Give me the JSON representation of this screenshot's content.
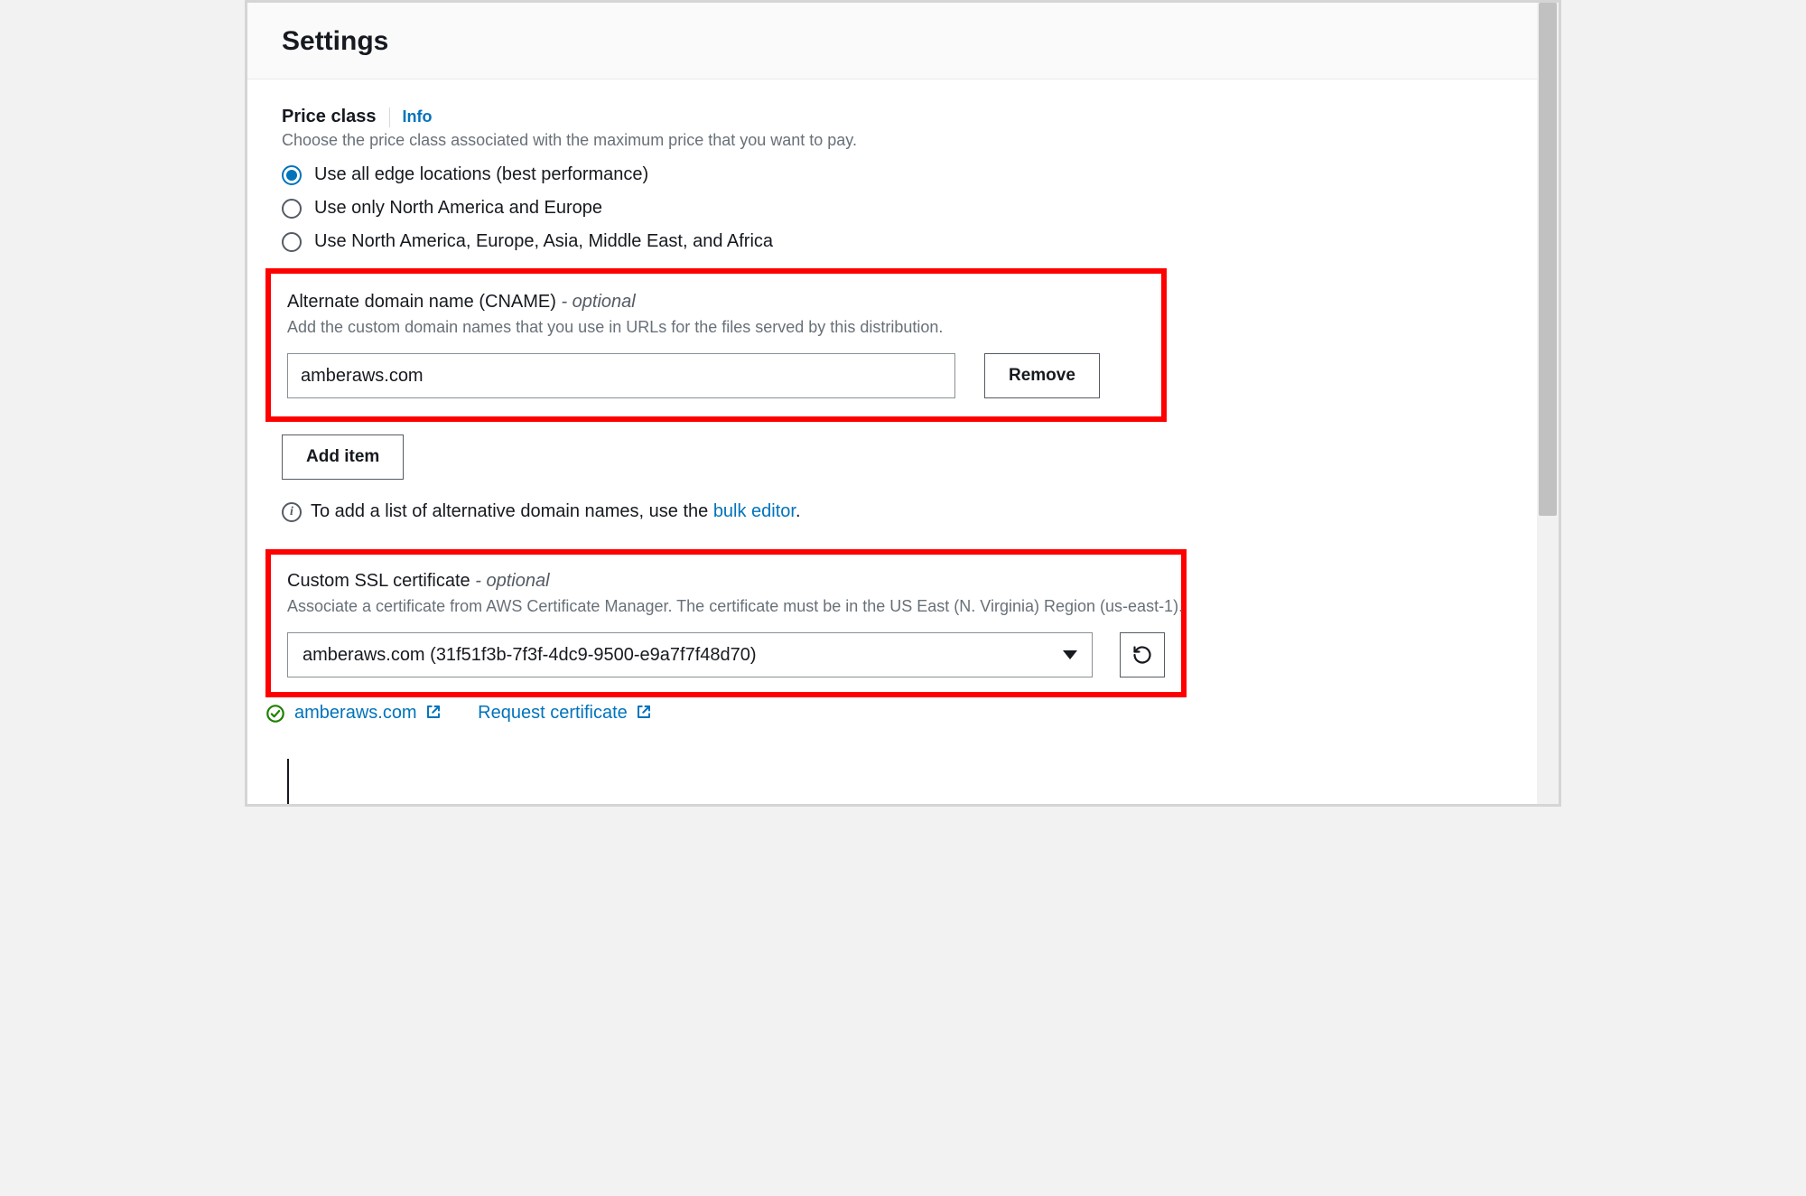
{
  "header": {
    "title": "Settings"
  },
  "price_class": {
    "label": "Price class",
    "info": "Info",
    "description": "Choose the price class associated with the maximum price that you want to pay.",
    "options": {
      "all": "Use all edge locations (best performance)",
      "na_eu": "Use only North America and Europe",
      "na_eu_asia": "Use North America, Europe, Asia, Middle East, and Africa"
    },
    "selected": "all"
  },
  "cname": {
    "heading_main": "Alternate domain name (CNAME) ",
    "heading_optional": "- optional",
    "description": "Add the custom domain names that you use in URLs for the files served by this distribution.",
    "value": "amberaws.com",
    "remove_label": "Remove",
    "add_item_label": "Add item"
  },
  "tip": {
    "prefix": "To add a list of alternative domain names, use the ",
    "link": "bulk editor",
    "suffix": "."
  },
  "ssl": {
    "heading_main": "Custom SSL certificate ",
    "heading_optional": "- optional",
    "description": "Associate a certificate from AWS Certificate Manager. The certificate must be in the US East (N. Virginia) Region (us-east-1).",
    "selected": "amberaws.com (31f51f3b-7f3f-4dc9-9500-e9a7f7f48d70)",
    "status_domain": "amberaws.com",
    "request_label": "Request certificate"
  }
}
